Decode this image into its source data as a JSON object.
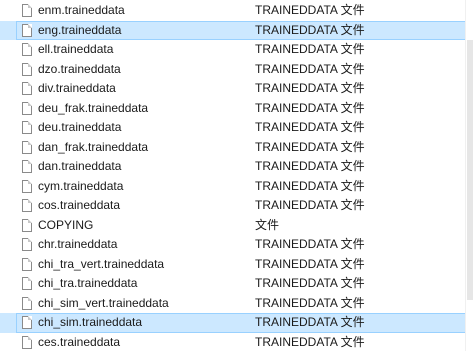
{
  "files": [
    {
      "name": "enm.traineddata",
      "type": "TRAINEDDATA 文件",
      "selected": false
    },
    {
      "name": "eng.traineddata",
      "type": "TRAINEDDATA 文件",
      "selected": true
    },
    {
      "name": "ell.traineddata",
      "type": "TRAINEDDATA 文件",
      "selected": false
    },
    {
      "name": "dzo.traineddata",
      "type": "TRAINEDDATA 文件",
      "selected": false
    },
    {
      "name": "div.traineddata",
      "type": "TRAINEDDATA 文件",
      "selected": false
    },
    {
      "name": "deu_frak.traineddata",
      "type": "TRAINEDDATA 文件",
      "selected": false
    },
    {
      "name": "deu.traineddata",
      "type": "TRAINEDDATA 文件",
      "selected": false
    },
    {
      "name": "dan_frak.traineddata",
      "type": "TRAINEDDATA 文件",
      "selected": false
    },
    {
      "name": "dan.traineddata",
      "type": "TRAINEDDATA 文件",
      "selected": false
    },
    {
      "name": "cym.traineddata",
      "type": "TRAINEDDATA 文件",
      "selected": false
    },
    {
      "name": "cos.traineddata",
      "type": "TRAINEDDATA 文件",
      "selected": false
    },
    {
      "name": "COPYING",
      "type": "文件",
      "selected": false
    },
    {
      "name": "chr.traineddata",
      "type": "TRAINEDDATA 文件",
      "selected": false
    },
    {
      "name": "chi_tra_vert.traineddata",
      "type": "TRAINEDDATA 文件",
      "selected": false
    },
    {
      "name": "chi_tra.traineddata",
      "type": "TRAINEDDATA 文件",
      "selected": false
    },
    {
      "name": "chi_sim_vert.traineddata",
      "type": "TRAINEDDATA 文件",
      "selected": false
    },
    {
      "name": "chi_sim.traineddata",
      "type": "TRAINEDDATA 文件",
      "selected": true
    },
    {
      "name": "ces.traineddata",
      "type": "TRAINEDDATA 文件",
      "selected": false
    }
  ],
  "icon": "file-icon",
  "colors": {
    "selection_background": "#cce8ff",
    "selection_border": "#99d1ff",
    "text": "#1a1a1a"
  }
}
